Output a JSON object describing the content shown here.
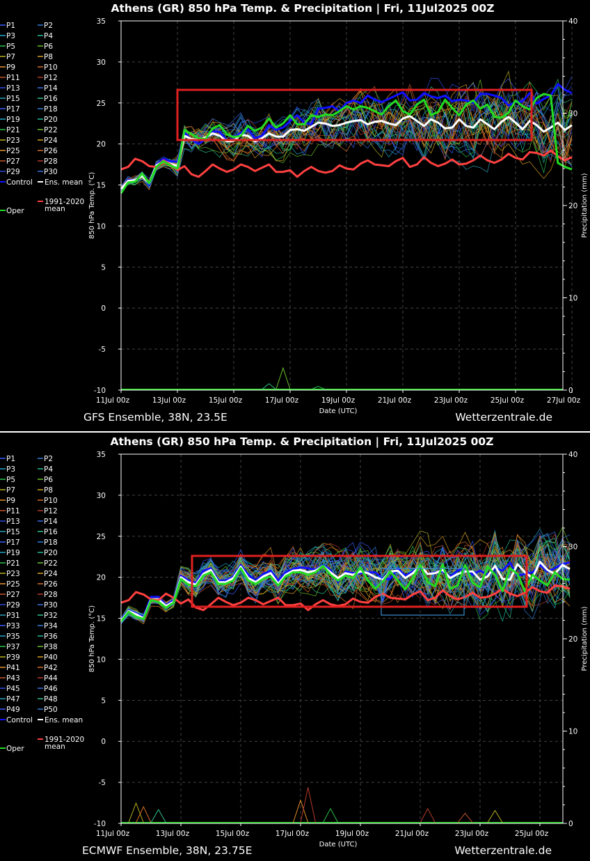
{
  "charts": [
    {
      "title": "Athens  (GR)  850 hPa Temp. & Precipitation | Fri, 11Jul2025 00Z",
      "ylabel_left": "850 hPa Temp. (°C)",
      "ylabel_right": "Precipitation (mm)",
      "xlabel": "Date (UTC)",
      "footer_left": "GFS Ensemble, 38N, 23.5E",
      "footer_right": "Wetterzentrale.de",
      "x_ticks": [
        "11Jul 00z",
        "13Jul 00z",
        "15Jul 00z",
        "17Jul 00z",
        "19Jul 00z",
        "21Jul 00z",
        "23Jul 00z",
        "25Jul 00z",
        "27Jul 00z"
      ],
      "y_ticks_left": [
        "35",
        "30",
        "25",
        "20",
        "15",
        "10",
        "5",
        "0",
        "-5",
        "-10"
      ],
      "y_ticks_right": [
        "40",
        "30",
        "20",
        "10",
        "0"
      ],
      "legend_members": [
        "P1",
        "P2",
        "P3",
        "P4",
        "P5",
        "P6",
        "P7",
        "P8",
        "P9",
        "P10",
        "P11",
        "P12",
        "P13",
        "P14",
        "P15",
        "P16",
        "P17",
        "P18",
        "P19",
        "P20",
        "P21",
        "P22",
        "P23",
        "P24",
        "P25",
        "P26",
        "P27",
        "P28",
        "P29",
        "P30"
      ],
      "legend_control": "Control",
      "legend_mean": "Ens. mean",
      "legend_climo": "1991-2020",
      "legend_climo2": "mean",
      "legend_oper": "Oper"
    },
    {
      "title": "Athens  (GR)  850 hPa Temp. & Precipitation | Fri, 11Jul2025 00Z",
      "ylabel_left": "850 hPa Temp. (°C)",
      "ylabel_right": "Precipitation (mm)",
      "xlabel": "Date (UTC)",
      "footer_left": "ECMWF Ensemble, 38N, 23.75E",
      "footer_right": "Wetterzentrale.de",
      "x_ticks": [
        "11Jul 00z",
        "13Jul 00z",
        "15Jul 00z",
        "17Jul 00z",
        "19Jul 00z",
        "21Jul 00z",
        "23Jul 00z",
        "25Jul 00z"
      ],
      "y_ticks_left": [
        "35",
        "30",
        "25",
        "20",
        "15",
        "10",
        "5",
        "0",
        "-5",
        "-10"
      ],
      "y_ticks_right": [
        "40",
        "30",
        "20",
        "10",
        "0"
      ],
      "legend_members": [
        "P1",
        "P2",
        "P3",
        "P4",
        "P5",
        "P6",
        "P7",
        "P8",
        "P9",
        "P10",
        "P11",
        "P12",
        "P13",
        "P14",
        "P15",
        "P16",
        "P17",
        "P18",
        "P19",
        "P20",
        "P21",
        "P22",
        "P23",
        "P24",
        "P25",
        "P26",
        "P27",
        "P28",
        "P29",
        "P30",
        "P31",
        "P32",
        "P33",
        "P34",
        "P35",
        "P36",
        "P37",
        "P38",
        "P39",
        "P40",
        "P41",
        "P42",
        "P43",
        "P44",
        "P45",
        "P46",
        "P47",
        "P48",
        "P49",
        "P50"
      ],
      "legend_control": "Control",
      "legend_mean": "Ens. mean",
      "legend_climo": "1991-2020",
      "legend_climo2": "mean",
      "legend_oper": "Oper"
    }
  ],
  "colors": {
    "control": "#1010ff",
    "mean": "#ffffff",
    "climo": "#ff4040",
    "oper": "#22dd22",
    "highlight_box": "#e02020",
    "ecmwf_inner_box": "#3a8fd0"
  },
  "chart_data": [
    {
      "type": "line",
      "x_range": [
        "2025-07-11 00z",
        "2025-07-27 00z"
      ],
      "ylim": [
        -10,
        35
      ],
      "ylim_right": [
        0,
        40
      ],
      "grid": true,
      "legend_placement": "left",
      "step_hours": 6,
      "series": [
        {
          "name": "Control",
          "values": [
            14.3,
            15.6,
            15.6,
            16.3,
            15.0,
            17.5,
            18.2,
            17.9,
            17.8,
            21.4,
            20.5,
            20.0,
            20.6,
            21.5,
            21.5,
            20.4,
            20.6,
            21.4,
            21.8,
            20.7,
            21.0,
            22.3,
            21.7,
            22.0,
            22.8,
            23.5,
            22.6,
            22.4,
            24.3,
            24.4,
            24.6,
            24.0,
            25.0,
            25.3,
            25.0,
            25.9,
            25.4,
            25.1,
            25.5,
            25.9,
            26.3,
            25.3,
            25.4,
            26.2,
            25.8,
            25.6,
            25.9,
            25.2,
            25.4,
            25.3,
            25.0,
            26.1,
            26.1,
            25.9,
            25.6,
            24.7,
            25.1,
            25.2,
            26.2,
            24.9,
            25.5,
            25.9,
            27.3,
            26.6,
            26.2
          ]
        },
        {
          "name": "Ens. mean",
          "values": [
            14.5,
            15.5,
            15.6,
            16.1,
            15.2,
            17.4,
            17.9,
            17.6,
            17.3,
            21.0,
            20.6,
            20.5,
            20.8,
            21.3,
            21.0,
            20.3,
            20.4,
            21.1,
            21.0,
            20.3,
            20.7,
            21.3,
            20.9,
            20.9,
            21.7,
            21.8,
            21.6,
            22.1,
            22.6,
            22.5,
            22.2,
            22.3,
            22.6,
            22.8,
            22.9,
            22.4,
            22.7,
            22.8,
            22.5,
            22.3,
            23.1,
            23.4,
            22.8,
            22.2,
            23.0,
            22.6,
            21.9,
            22.0,
            23.0,
            22.2,
            22.0,
            23.0,
            22.4,
            21.8,
            22.7,
            23.3,
            22.6,
            21.8,
            22.8,
            22.3,
            21.5,
            22.0,
            22.6,
            21.7,
            22.3
          ]
        },
        {
          "name": "1991-2020 mean",
          "values": [
            16.9,
            17.2,
            18.2,
            17.9,
            17.3,
            17.2,
            18.0,
            17.5,
            16.8,
            17.3,
            16.3,
            16.0,
            16.7,
            17.5,
            17.0,
            16.6,
            16.9,
            17.5,
            17.2,
            16.7,
            17.1,
            17.5,
            16.6,
            16.6,
            16.8,
            16.0,
            16.7,
            17.2,
            16.7,
            16.5,
            16.7,
            17.4,
            17.0,
            16.9,
            17.6,
            18.0,
            17.5,
            17.4,
            17.3,
            17.9,
            18.3,
            17.2,
            17.5,
            18.4,
            17.7,
            17.3,
            17.6,
            18.1,
            17.5,
            17.6,
            18.0,
            18.6,
            18.0,
            17.7,
            18.1,
            18.8,
            18.3,
            18.1,
            19.0,
            18.9,
            18.6,
            19.2,
            18.5,
            18.0,
            18.4
          ]
        },
        {
          "name": "Oper",
          "values": [
            14.0,
            15.3,
            15.4,
            16.4,
            15.2,
            17.2,
            17.9,
            17.4,
            17.0,
            21.7,
            21.2,
            20.7,
            20.6,
            21.9,
            22.3,
            21.2,
            20.8,
            21.0,
            22.2,
            21.6,
            22.0,
            23.1,
            22.0,
            22.5,
            23.5,
            22.4,
            22.4,
            23.5,
            23.3,
            23.6,
            23.5,
            24.0,
            24.6,
            24.2,
            24.6,
            24.4,
            24.0,
            23.6,
            24.6,
            25.3,
            24.0,
            23.6,
            24.8,
            25.4,
            23.5,
            23.9,
            25.4,
            24.4,
            23.5,
            24.8,
            25.3,
            24.3,
            24.8,
            23.3,
            23.2,
            23.8,
            25.3,
            24.6,
            24.2,
            25.6,
            26.1,
            25.9,
            17.7,
            17.2,
            16.9
          ]
        }
      ]
    },
    {
      "type": "line",
      "x_range": [
        "2025-07-11 00z",
        "2025-07-26 00z"
      ],
      "ylim": [
        -10,
        35
      ],
      "ylim_right": [
        0,
        40
      ],
      "grid": true,
      "legend_placement": "left",
      "step_hours": 6,
      "series": [
        {
          "name": "Control",
          "values": [
            14.9,
            16.0,
            15.6,
            15.2,
            17.6,
            17.6,
            16.6,
            17.2,
            20.2,
            19.6,
            19.3,
            20.8,
            21.1,
            19.6,
            19.6,
            20.1,
            21.5,
            20.3,
            19.6,
            20.4,
            20.8,
            19.6,
            20.6,
            21.0,
            21.2,
            21.1,
            20.9,
            21.5,
            20.9,
            19.4,
            20.7,
            20.5,
            20.5,
            20.6,
            20.6,
            19.8,
            19.8,
            21.1,
            20.2,
            20.7,
            21.3,
            20.4,
            20.6,
            20.7,
            20.1,
            20.8,
            21.2,
            20.3,
            20.8,
            20.3,
            21.1,
            20.8,
            21.8,
            20.2,
            20.4,
            20.6,
            21.5,
            20.7,
            21.1,
            21.6,
            21.8
          ]
        },
        {
          "name": "Ens. mean",
          "values": [
            14.7,
            15.9,
            15.5,
            15.0,
            17.3,
            17.3,
            16.5,
            17.0,
            20.0,
            19.4,
            19.1,
            20.4,
            20.9,
            19.4,
            19.4,
            19.9,
            21.3,
            19.9,
            19.4,
            20.1,
            20.5,
            19.2,
            20.3,
            20.8,
            20.9,
            20.6,
            20.8,
            21.4,
            20.6,
            19.9,
            20.5,
            20.3,
            20.7,
            20.5,
            20.0,
            19.7,
            20.7,
            20.8,
            19.9,
            20.5,
            21.4,
            20.4,
            20.5,
            20.9,
            19.9,
            20.4,
            20.7,
            20.7,
            19.7,
            20.1,
            21.4,
            19.8,
            19.7,
            21.6,
            20.6,
            19.9,
            21.9,
            20.9,
            20.4,
            21.5,
            21.0
          ]
        },
        {
          "name": "1991-2020 mean",
          "values": [
            16.9,
            17.2,
            18.2,
            17.9,
            17.3,
            17.2,
            18.0,
            17.5,
            16.8,
            17.3,
            16.3,
            16.0,
            16.7,
            17.5,
            17.0,
            16.6,
            16.9,
            17.5,
            17.2,
            16.7,
            17.1,
            17.5,
            16.6,
            16.6,
            16.8,
            16.0,
            16.7,
            17.2,
            16.7,
            16.5,
            16.7,
            17.4,
            17.0,
            16.9,
            17.6,
            18.0,
            17.5,
            17.4,
            17.3,
            17.9,
            18.3,
            17.2,
            17.5,
            18.4,
            17.7,
            17.3,
            17.6,
            18.1,
            17.5,
            17.6,
            18.0,
            18.6,
            18.0,
            17.7,
            18.1,
            18.8,
            18.3,
            18.1,
            19.0,
            18.9,
            18.6
          ]
        },
        {
          "name": "Oper",
          "values": [
            14.6,
            15.8,
            15.2,
            14.9,
            17.2,
            17.0,
            16.3,
            16.9,
            19.8,
            19.1,
            18.9,
            20.2,
            20.6,
            19.2,
            19.2,
            19.6,
            21.1,
            19.6,
            19.2,
            19.8,
            20.1,
            19.0,
            20.1,
            20.6,
            20.6,
            20.3,
            20.6,
            21.4,
            20.3,
            19.6,
            20.2,
            19.9,
            21.2,
            19.6,
            18.6,
            19.5,
            20.7,
            19.6,
            18.5,
            19.9,
            21.5,
            19.4,
            18.9,
            21.6,
            18.6,
            19.0,
            21.5,
            19.3,
            18.8,
            21.3,
            20.3,
            18.3,
            21.1,
            20.4,
            18.3,
            20.3,
            19.6,
            19.0,
            20.6,
            19.8,
            19.7
          ]
        }
      ]
    }
  ]
}
